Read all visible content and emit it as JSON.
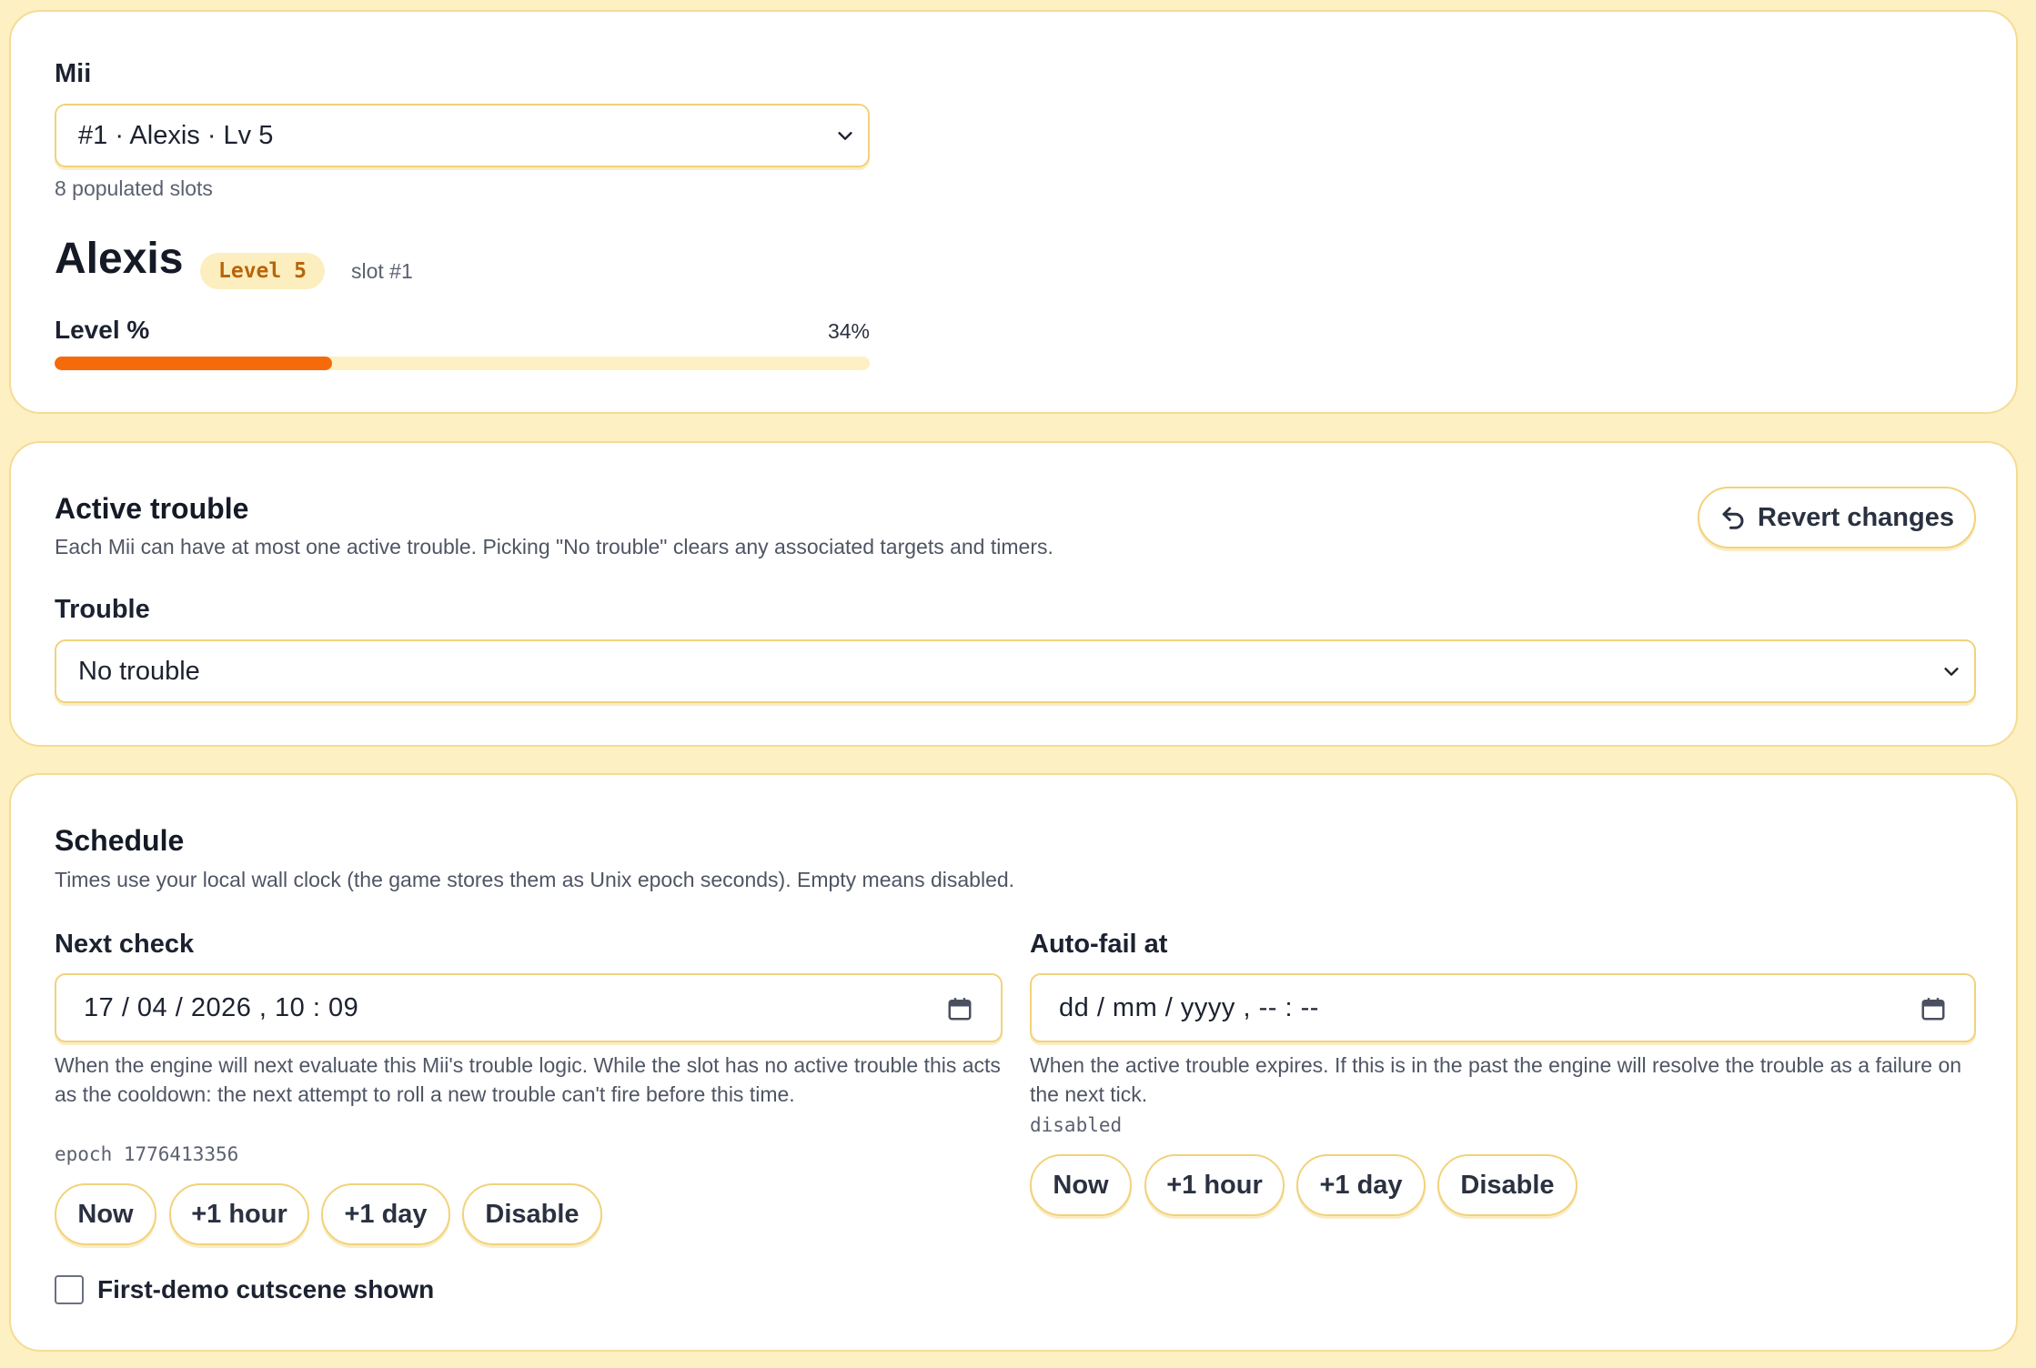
{
  "mii_card": {
    "label": "Mii",
    "selected": "#1 · Alexis · Lv 5",
    "slots_note": "8 populated slots",
    "name": "Alexis",
    "level_badge": "Level 5",
    "slot_label": "slot #1",
    "level_pct_label": "Level %",
    "level_pct_value": "34%",
    "level_pct_fraction": 0.34,
    "progress_color": "#f56a0a"
  },
  "trouble_card": {
    "title": "Active trouble",
    "description": "Each Mii can have at most one active trouble. Picking \"No trouble\" clears any associated targets and timers.",
    "revert_label": "Revert changes",
    "trouble_label": "Trouble",
    "trouble_selected": "No trouble"
  },
  "schedule_card": {
    "title": "Schedule",
    "description": "Times use your local wall clock (the game stores them as Unix epoch seconds). Empty means disabled.",
    "next_check": {
      "label": "Next check",
      "value": "17 / 04 / 2026 ,  10 : 09",
      "help": "When the engine will next evaluate this Mii's trouble logic. While the slot has no active trouble this acts as the cooldown: the next attempt to roll a new trouble can't fire before this time.",
      "epoch": "epoch 1776413356",
      "buttons": [
        "Now",
        "+1 hour",
        "+1 day",
        "Disable"
      ]
    },
    "auto_fail": {
      "label": "Auto-fail at",
      "value": "dd / mm / yyyy ,  -- : --",
      "help": "When the active trouble expires. If this is in the past the engine will resolve the trouble as a failure on the next tick.",
      "epoch": "disabled",
      "buttons": [
        "Now",
        "+1 hour",
        "+1 day",
        "Disable"
      ]
    },
    "checkbox_label": "First-demo cutscene shown",
    "checkbox_checked": false
  },
  "colors": {
    "background": "#fdf0c2",
    "card_border": "#f4dc95",
    "accent": "#f56a0a",
    "badge_bg": "#fdeec0",
    "badge_text": "#b8650a"
  }
}
